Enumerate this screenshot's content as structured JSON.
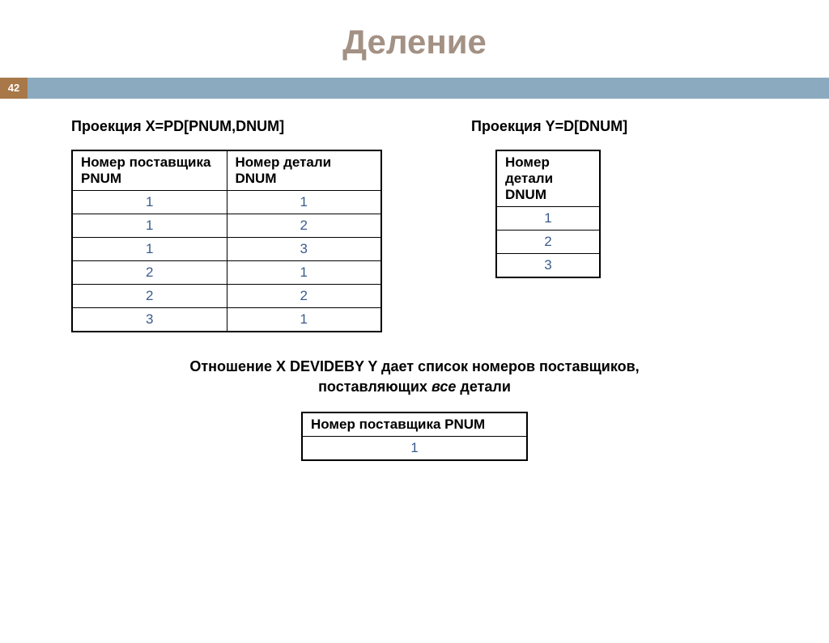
{
  "title": "Деление",
  "page_number": "42",
  "projection_x_heading": "Проекция X=PD[PNUM,DNUM]",
  "projection_y_heading": "Проекция Y=D[DNUM]",
  "table_x": {
    "header1": "Номер поставщика PNUM",
    "header2": "Номер детали DNUM",
    "rows": [
      {
        "c1": "1",
        "c2": "1"
      },
      {
        "c1": "1",
        "c2": "2"
      },
      {
        "c1": "1",
        "c2": "3"
      },
      {
        "c1": "2",
        "c2": "1"
      },
      {
        "c1": "2",
        "c2": "2"
      },
      {
        "c1": "3",
        "c2": "1"
      }
    ]
  },
  "table_y": {
    "header": "Номер детали DNUM",
    "rows": [
      "1",
      "2",
      "3"
    ]
  },
  "result_caption_line1": "Отношение X DEVIDEBY Y дает список номеров поставщиков,",
  "result_caption_line2a": "поставляющих ",
  "result_caption_line2_italic": "все",
  "result_caption_line2b": " детали",
  "table_result": {
    "header": "Номер поставщика PNUM",
    "rows": [
      "1"
    ]
  }
}
